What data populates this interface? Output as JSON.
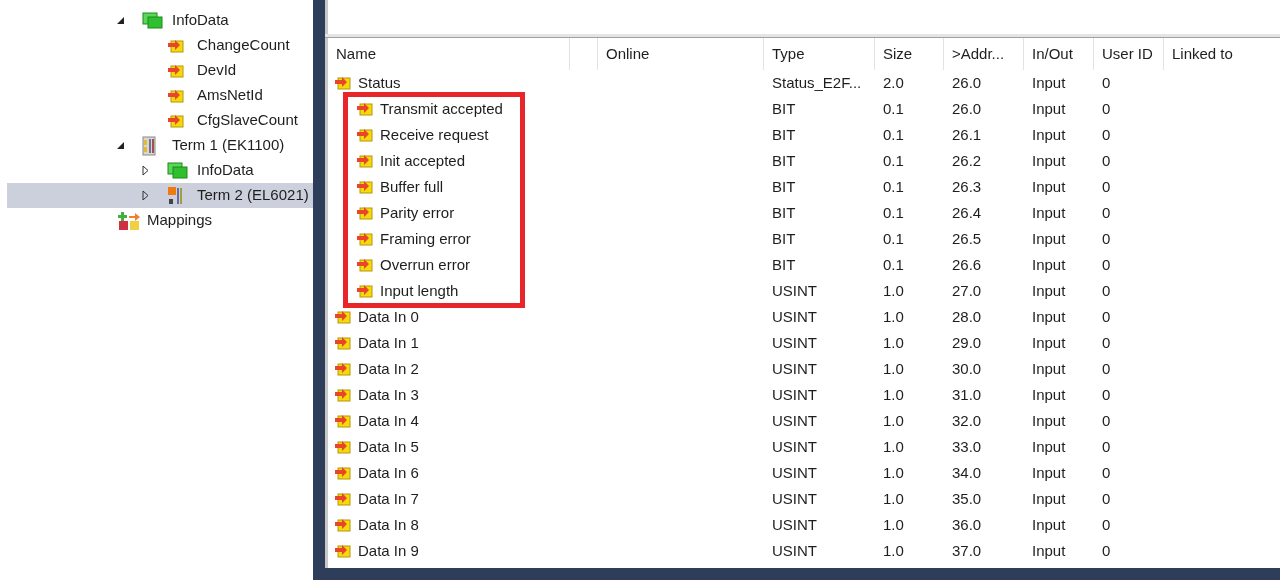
{
  "tree": {
    "children": [
      {
        "label": "InfoData",
        "kind": "group",
        "expanded": true,
        "selected": false,
        "children": [
          {
            "label": "ChangeCount",
            "kind": "variable",
            "selected": false
          },
          {
            "label": "DevId",
            "kind": "variable",
            "selected": false
          },
          {
            "label": "AmsNetId",
            "kind": "variable",
            "selected": false
          },
          {
            "label": "CfgSlaveCount",
            "kind": "variable",
            "selected": false
          }
        ]
      },
      {
        "label": "Term 1 (EK1100)",
        "kind": "coupler",
        "expanded": true,
        "selected": false,
        "children": [
          {
            "label": "InfoData",
            "kind": "group",
            "expanded": false,
            "selected": false
          },
          {
            "label": "Term 2 (EL6021)",
            "kind": "terminal",
            "expanded": false,
            "selected": true
          }
        ]
      }
    ],
    "siblings": [
      {
        "label": "Mappings",
        "kind": "mappings",
        "selected": false
      }
    ]
  },
  "table": {
    "columns": [
      "Name",
      "",
      "Online",
      "Type",
      "Size",
      ">Addr...",
      "In/Out",
      "User ID",
      "Linked to"
    ],
    "rows": [
      {
        "name": "Status",
        "type": "Status_E2F...",
        "size": "2.0",
        "addr": "26.0",
        "inout": "Input",
        "userid": "0",
        "children": [
          {
            "name": "Transmit accepted",
            "type": "BIT",
            "size": "0.1",
            "addr": "26.0",
            "inout": "Input",
            "userid": "0"
          },
          {
            "name": "Receive request",
            "type": "BIT",
            "size": "0.1",
            "addr": "26.1",
            "inout": "Input",
            "userid": "0"
          },
          {
            "name": "Init accepted",
            "type": "BIT",
            "size": "0.1",
            "addr": "26.2",
            "inout": "Input",
            "userid": "0"
          },
          {
            "name": "Buffer full",
            "type": "BIT",
            "size": "0.1",
            "addr": "26.3",
            "inout": "Input",
            "userid": "0"
          },
          {
            "name": "Parity error",
            "type": "BIT",
            "size": "0.1",
            "addr": "26.4",
            "inout": "Input",
            "userid": "0"
          },
          {
            "name": "Framing error",
            "type": "BIT",
            "size": "0.1",
            "addr": "26.5",
            "inout": "Input",
            "userid": "0"
          },
          {
            "name": "Overrun error",
            "type": "BIT",
            "size": "0.1",
            "addr": "26.6",
            "inout": "Input",
            "userid": "0"
          },
          {
            "name": "Input length",
            "type": "USINT",
            "size": "1.0",
            "addr": "27.0",
            "inout": "Input",
            "userid": "0"
          }
        ]
      },
      {
        "name": "Data In 0",
        "type": "USINT",
        "size": "1.0",
        "addr": "28.0",
        "inout": "Input",
        "userid": "0"
      },
      {
        "name": "Data In 1",
        "type": "USINT",
        "size": "1.0",
        "addr": "29.0",
        "inout": "Input",
        "userid": "0"
      },
      {
        "name": "Data In 2",
        "type": "USINT",
        "size": "1.0",
        "addr": "30.0",
        "inout": "Input",
        "userid": "0"
      },
      {
        "name": "Data In 3",
        "type": "USINT",
        "size": "1.0",
        "addr": "31.0",
        "inout": "Input",
        "userid": "0"
      },
      {
        "name": "Data In 4",
        "type": "USINT",
        "size": "1.0",
        "addr": "32.0",
        "inout": "Input",
        "userid": "0"
      },
      {
        "name": "Data In 5",
        "type": "USINT",
        "size": "1.0",
        "addr": "33.0",
        "inout": "Input",
        "userid": "0"
      },
      {
        "name": "Data In 6",
        "type": "USINT",
        "size": "1.0",
        "addr": "34.0",
        "inout": "Input",
        "userid": "0"
      },
      {
        "name": "Data In 7",
        "type": "USINT",
        "size": "1.0",
        "addr": "35.0",
        "inout": "Input",
        "userid": "0"
      },
      {
        "name": "Data In 8",
        "type": "USINT",
        "size": "1.0",
        "addr": "36.0",
        "inout": "Input",
        "userid": "0"
      },
      {
        "name": "Data In 9",
        "type": "USINT",
        "size": "1.0",
        "addr": "37.0",
        "inout": "Input",
        "userid": "0"
      }
    ]
  }
}
